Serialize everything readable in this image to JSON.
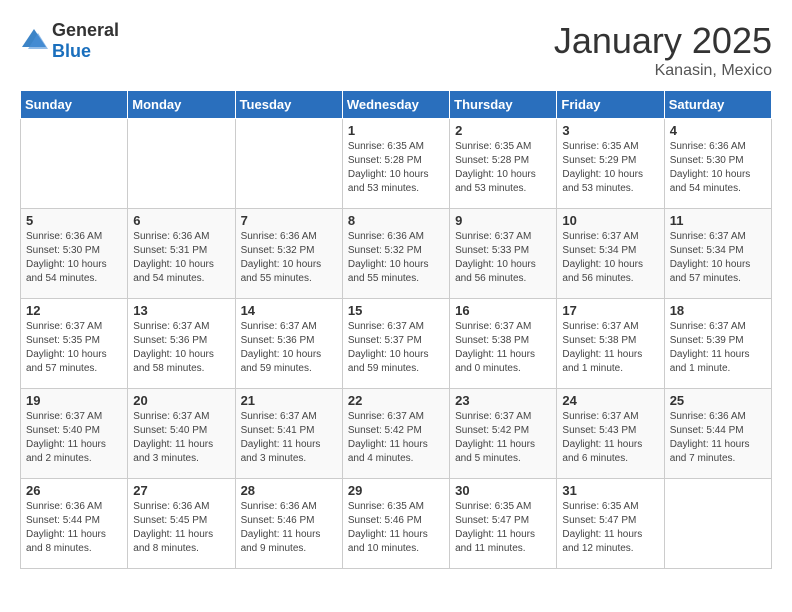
{
  "header": {
    "logo_general": "General",
    "logo_blue": "Blue",
    "title": "January 2025",
    "subtitle": "Kanasin, Mexico"
  },
  "weekdays": [
    "Sunday",
    "Monday",
    "Tuesday",
    "Wednesday",
    "Thursday",
    "Friday",
    "Saturday"
  ],
  "weeks": [
    [
      {
        "day": "",
        "info": ""
      },
      {
        "day": "",
        "info": ""
      },
      {
        "day": "",
        "info": ""
      },
      {
        "day": "1",
        "info": "Sunrise: 6:35 AM\nSunset: 5:28 PM\nDaylight: 10 hours\nand 53 minutes."
      },
      {
        "day": "2",
        "info": "Sunrise: 6:35 AM\nSunset: 5:28 PM\nDaylight: 10 hours\nand 53 minutes."
      },
      {
        "day": "3",
        "info": "Sunrise: 6:35 AM\nSunset: 5:29 PM\nDaylight: 10 hours\nand 53 minutes."
      },
      {
        "day": "4",
        "info": "Sunrise: 6:36 AM\nSunset: 5:30 PM\nDaylight: 10 hours\nand 54 minutes."
      }
    ],
    [
      {
        "day": "5",
        "info": "Sunrise: 6:36 AM\nSunset: 5:30 PM\nDaylight: 10 hours\nand 54 minutes."
      },
      {
        "day": "6",
        "info": "Sunrise: 6:36 AM\nSunset: 5:31 PM\nDaylight: 10 hours\nand 54 minutes."
      },
      {
        "day": "7",
        "info": "Sunrise: 6:36 AM\nSunset: 5:32 PM\nDaylight: 10 hours\nand 55 minutes."
      },
      {
        "day": "8",
        "info": "Sunrise: 6:36 AM\nSunset: 5:32 PM\nDaylight: 10 hours\nand 55 minutes."
      },
      {
        "day": "9",
        "info": "Sunrise: 6:37 AM\nSunset: 5:33 PM\nDaylight: 10 hours\nand 56 minutes."
      },
      {
        "day": "10",
        "info": "Sunrise: 6:37 AM\nSunset: 5:34 PM\nDaylight: 10 hours\nand 56 minutes."
      },
      {
        "day": "11",
        "info": "Sunrise: 6:37 AM\nSunset: 5:34 PM\nDaylight: 10 hours\nand 57 minutes."
      }
    ],
    [
      {
        "day": "12",
        "info": "Sunrise: 6:37 AM\nSunset: 5:35 PM\nDaylight: 10 hours\nand 57 minutes."
      },
      {
        "day": "13",
        "info": "Sunrise: 6:37 AM\nSunset: 5:36 PM\nDaylight: 10 hours\nand 58 minutes."
      },
      {
        "day": "14",
        "info": "Sunrise: 6:37 AM\nSunset: 5:36 PM\nDaylight: 10 hours\nand 59 minutes."
      },
      {
        "day": "15",
        "info": "Sunrise: 6:37 AM\nSunset: 5:37 PM\nDaylight: 10 hours\nand 59 minutes."
      },
      {
        "day": "16",
        "info": "Sunrise: 6:37 AM\nSunset: 5:38 PM\nDaylight: 11 hours\nand 0 minutes."
      },
      {
        "day": "17",
        "info": "Sunrise: 6:37 AM\nSunset: 5:38 PM\nDaylight: 11 hours\nand 1 minute."
      },
      {
        "day": "18",
        "info": "Sunrise: 6:37 AM\nSunset: 5:39 PM\nDaylight: 11 hours\nand 1 minute."
      }
    ],
    [
      {
        "day": "19",
        "info": "Sunrise: 6:37 AM\nSunset: 5:40 PM\nDaylight: 11 hours\nand 2 minutes."
      },
      {
        "day": "20",
        "info": "Sunrise: 6:37 AM\nSunset: 5:40 PM\nDaylight: 11 hours\nand 3 minutes."
      },
      {
        "day": "21",
        "info": "Sunrise: 6:37 AM\nSunset: 5:41 PM\nDaylight: 11 hours\nand 3 minutes."
      },
      {
        "day": "22",
        "info": "Sunrise: 6:37 AM\nSunset: 5:42 PM\nDaylight: 11 hours\nand 4 minutes."
      },
      {
        "day": "23",
        "info": "Sunrise: 6:37 AM\nSunset: 5:42 PM\nDaylight: 11 hours\nand 5 minutes."
      },
      {
        "day": "24",
        "info": "Sunrise: 6:37 AM\nSunset: 5:43 PM\nDaylight: 11 hours\nand 6 minutes."
      },
      {
        "day": "25",
        "info": "Sunrise: 6:36 AM\nSunset: 5:44 PM\nDaylight: 11 hours\nand 7 minutes."
      }
    ],
    [
      {
        "day": "26",
        "info": "Sunrise: 6:36 AM\nSunset: 5:44 PM\nDaylight: 11 hours\nand 8 minutes."
      },
      {
        "day": "27",
        "info": "Sunrise: 6:36 AM\nSunset: 5:45 PM\nDaylight: 11 hours\nand 8 minutes."
      },
      {
        "day": "28",
        "info": "Sunrise: 6:36 AM\nSunset: 5:46 PM\nDaylight: 11 hours\nand 9 minutes."
      },
      {
        "day": "29",
        "info": "Sunrise: 6:35 AM\nSunset: 5:46 PM\nDaylight: 11 hours\nand 10 minutes."
      },
      {
        "day": "30",
        "info": "Sunrise: 6:35 AM\nSunset: 5:47 PM\nDaylight: 11 hours\nand 11 minutes."
      },
      {
        "day": "31",
        "info": "Sunrise: 6:35 AM\nSunset: 5:47 PM\nDaylight: 11 hours\nand 12 minutes."
      },
      {
        "day": "",
        "info": ""
      }
    ]
  ]
}
